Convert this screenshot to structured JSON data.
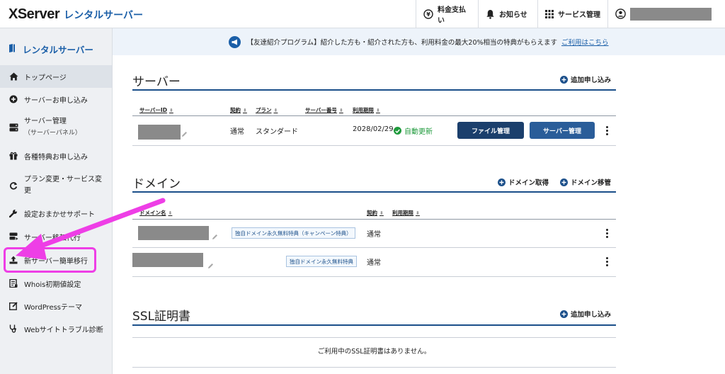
{
  "header": {
    "logo_brand": "XServer",
    "logo_sub": "レンタルサーバー",
    "nav": {
      "payment": "料金支払い",
      "notice": "お知らせ",
      "service": "サービス管理"
    }
  },
  "sidebar": {
    "title": "レンタルサーバー",
    "items": [
      {
        "label": "トップページ",
        "icon": "home-icon",
        "active": true
      },
      {
        "label": "サーバーお申し込み",
        "icon": "plus-circle-icon"
      },
      {
        "label": "サーバー管理",
        "sub": "（サーバーパネル）",
        "icon": "server-icon"
      },
      {
        "label": "各種特典お申し込み",
        "icon": "gift-icon"
      },
      {
        "label": "プラン変更・サービス変更",
        "icon": "refresh-icon"
      },
      {
        "label": "設定おまかせサポート",
        "icon": "wrench-icon"
      },
      {
        "label": "サーバー移転代行",
        "icon": "server-transfer-icon"
      },
      {
        "label": "新サーバー簡単移行",
        "icon": "upload-icon",
        "highlighted": true
      },
      {
        "label": "Whois初期値設定",
        "icon": "document-icon"
      },
      {
        "label": "WordPressテーマ",
        "icon": "edit-box-icon"
      },
      {
        "label": "Webサイトトラブル診断",
        "icon": "stethoscope-icon"
      }
    ]
  },
  "banner": {
    "text": "【友達紹介プログラム】紹介した方も・紹介された方も、利用料金の最大20%相当の特典がもらえます",
    "link": "ご利用はこちら"
  },
  "server_section": {
    "title": "サーバー",
    "add_link": "追加申し込み",
    "headers": [
      "サーバーID",
      "契約",
      "プラン",
      "サーバー番号",
      "利用期限"
    ],
    "row": {
      "contract": "通常",
      "plan": "スタンダード",
      "expiry": "2028/02/29",
      "auto_renew": "自動更新",
      "file_button": "ファイル管理",
      "server_button": "サーバー管理"
    }
  },
  "domain_section": {
    "title": "ドメイン",
    "acquire_link": "ドメイン取得",
    "transfer_link": "ドメイン移管",
    "headers": [
      "ドメイン名",
      "契約",
      "利用期限"
    ],
    "rows": [
      {
        "tag": "独自ドメイン永久無料特典（キャンペーン特典）",
        "contract": "通常"
      },
      {
        "tag": "独自ドメイン永久無料特典",
        "contract": "通常"
      }
    ]
  },
  "ssl_section": {
    "title": "SSL証明書",
    "add_link": "追加申し込み",
    "empty_message": "ご利用中のSSL証明書はありません。"
  },
  "colors": {
    "brand_blue": "#1b5fa8",
    "dark_navy": "#1b3f6c",
    "success_green": "#1f9a3c",
    "annotation_magenta": "#ee3ee6"
  }
}
